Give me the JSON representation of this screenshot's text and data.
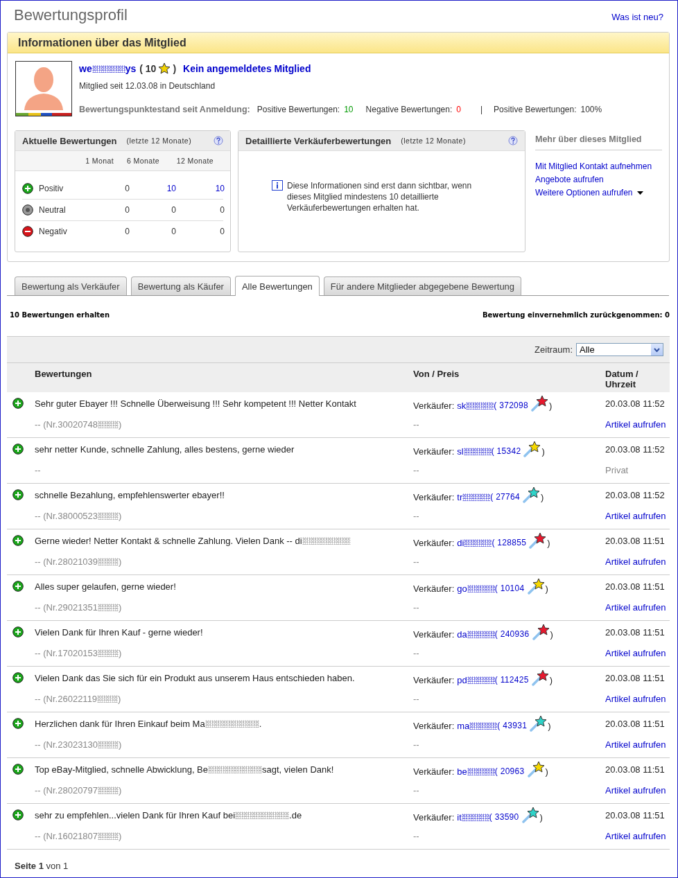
{
  "page_title": "Bewertungsprofil",
  "whats_new": "Was ist neu?",
  "member_panel": {
    "title": "Informationen über das Mitglied",
    "username_parts": [
      "we",
      "ys"
    ],
    "score_open": "( 10",
    "score_close": ")",
    "status": "Kein angemeldetes Mitglied",
    "since": "Mitglied seit 12.03.08 in Deutschland",
    "points_label": "Bewertungspunktestand seit Anmeldung:",
    "points": [
      {
        "kind": "positive",
        "label": "Positive Bewertungen:",
        "value": "10"
      },
      {
        "kind": "negative",
        "label": "Negative Bewertungen:",
        "value": "0"
      },
      {
        "kind": "separator",
        "label": "|"
      },
      {
        "kind": "plain",
        "label": "Positive Bewertungen:",
        "value": "100%"
      }
    ]
  },
  "recent": {
    "title": "Aktuelle Bewertungen",
    "subtitle": "(letzte 12 Monate)",
    "columns": [
      "1 Monat",
      "6 Monate",
      "12 Monate"
    ],
    "rows": [
      {
        "kind": "positive",
        "label": "Positiv",
        "values": [
          {
            "text": "0",
            "link": false
          },
          {
            "text": "10",
            "link": true
          },
          {
            "text": "10",
            "link": true
          }
        ]
      },
      {
        "kind": "neutral",
        "label": "Neutral",
        "values": [
          {
            "text": "0",
            "link": false
          },
          {
            "text": "0",
            "link": false
          },
          {
            "text": "0",
            "link": false
          }
        ]
      },
      {
        "kind": "negative",
        "label": "Negativ",
        "values": [
          {
            "text": "0",
            "link": false
          },
          {
            "text": "0",
            "link": false
          },
          {
            "text": "0",
            "link": false
          }
        ]
      }
    ]
  },
  "detailed": {
    "title": "Detaillierte Verkäuferbewertungen",
    "subtitle": "(letzte 12 Monate)",
    "info": "Diese Informationen sind erst dann sichtbar, wenn dieses Mitglied mindestens 10 detaillierte Verkäuferbewertungen erhalten hat."
  },
  "more": {
    "title": "Mehr über dieses Mitglied",
    "links": [
      {
        "text": "Mit Mitglied Kontakt aufnehmen",
        "dropdown": false
      },
      {
        "text": "Angebote aufrufen",
        "dropdown": false
      },
      {
        "text": "Weitere Optionen aufrufen",
        "dropdown": true
      }
    ]
  },
  "tabs": [
    {
      "label": "Bewertung als Verkäufer",
      "selected": false
    },
    {
      "label": "Bewertung als Käufer",
      "selected": false
    },
    {
      "label": "Alle Bewertungen",
      "selected": true
    },
    {
      "label": "Für andere Mitglieder abgegebene Bewertung",
      "selected": false
    }
  ],
  "summary": {
    "received": "10 Bewertungen erhalten",
    "withdrawn": "Bewertung einvernehmlich zurückgenommen: 0"
  },
  "filter": {
    "label": "Zeitraum:",
    "value": "Alle"
  },
  "columns": [
    "Bewertungen",
    "Von / Preis",
    "Datum / Uhrzeit"
  ],
  "rows": [
    {
      "kind": "positive",
      "comment_parts": [
        "Sehr guter Ebayer !!! Schnelle Überweisung !!! Sehr kompetent !!! Netter Kontakt"
      ],
      "item_parts": [
        "-- (Nr.30020748",
        ")"
      ],
      "role": "Verkäufer:",
      "seller": "sk",
      "seller_score": "( 372098",
      "color": "#e8182e",
      "close": ")",
      "price": "--",
      "date": "20.03.08 11:52",
      "action": {
        "kind": "link",
        "text": "Artikel aufrufen"
      }
    },
    {
      "kind": "positive",
      "comment_parts": [
        "sehr netter Kunde, schnelle Zahlung, alles bestens, gerne wieder"
      ],
      "item_parts": [
        "--"
      ],
      "role": "Verkäufer:",
      "seller": "sl",
      "seller_score": "( 15342",
      "color": "#f5d800",
      "close": ")",
      "price": "--",
      "date": "20.03.08 11:52",
      "action": {
        "kind": "private",
        "text": "Privat"
      }
    },
    {
      "kind": "positive",
      "comment_parts": [
        "schnelle Bezahlung, empfehlenswerter ebayer!!"
      ],
      "item_parts": [
        "-- (Nr.38000523",
        ")"
      ],
      "role": "Verkäufer:",
      "seller": "tr",
      "seller_score": "( 27764",
      "color": "#2ed3c8",
      "close": ")",
      "price": "--",
      "date": "20.03.08 11:52",
      "action": {
        "kind": "link",
        "text": "Artikel aufrufen"
      }
    },
    {
      "kind": "positive",
      "comment_parts": [
        "Gerne wieder! Netter Kontakt & schnelle Zahlung. Vielen Dank -- di"
      ],
      "item_parts": [
        "-- (Nr.28021039",
        ")"
      ],
      "role": "Verkäufer:",
      "seller": "di",
      "seller_score": "( 128855",
      "color": "#e8182e",
      "close": ")",
      "price": "--",
      "date": "20.03.08 11:51",
      "action": {
        "kind": "link",
        "text": "Artikel aufrufen"
      }
    },
    {
      "kind": "positive",
      "comment_parts": [
        "Alles super gelaufen, gerne wieder!"
      ],
      "item_parts": [
        "-- (Nr.29021351",
        ")"
      ],
      "role": "Verkäufer:",
      "seller": "go",
      "seller_score": "( 10104",
      "color": "#f5d800",
      "close": ")",
      "price": "--",
      "date": "20.03.08 11:51",
      "action": {
        "kind": "link",
        "text": "Artikel aufrufen"
      }
    },
    {
      "kind": "positive",
      "comment_parts": [
        "Vielen Dank für Ihren Kauf - gerne wieder!"
      ],
      "item_parts": [
        "-- (Nr.17020153",
        ")"
      ],
      "role": "Verkäufer:",
      "seller": "da",
      "seller_score": "( 240936",
      "color": "#e8182e",
      "close": ")",
      "price": "--",
      "date": "20.03.08 11:51",
      "action": {
        "kind": "link",
        "text": "Artikel aufrufen"
      }
    },
    {
      "kind": "positive",
      "comment_parts": [
        "Vielen Dank das Sie sich für ein Produkt aus unserem Haus entschieden haben."
      ],
      "item_parts": [
        "-- (Nr.26022119",
        ")"
      ],
      "role": "Verkäufer:",
      "seller": "pd",
      "seller_score": "( 112425",
      "color": "#e8182e",
      "close": ")",
      "price": "--",
      "date": "20.03.08 11:51",
      "action": {
        "kind": "link",
        "text": "Artikel aufrufen"
      }
    },
    {
      "kind": "positive",
      "comment_parts": [
        "Herzlichen dank für Ihren Einkauf beim Ma",
        "."
      ],
      "item_parts": [
        "-- (Nr.23023130",
        ")"
      ],
      "role": "Verkäufer:",
      "seller": "ma",
      "seller_score": "( 43931",
      "color": "#2ed3c8",
      "close": ")",
      "price": "--",
      "date": "20.03.08 11:51",
      "action": {
        "kind": "link",
        "text": "Artikel aufrufen"
      }
    },
    {
      "kind": "positive",
      "comment_parts": [
        "Top eBay-Mitglied, schnelle Abwicklung, Be",
        "sagt, vielen Dank!"
      ],
      "item_parts": [
        "-- (Nr.28020797",
        ")"
      ],
      "role": "Verkäufer:",
      "seller": "be",
      "seller_score": "( 20963",
      "color": "#f5d800",
      "close": ")",
      "price": "--",
      "date": "20.03.08 11:51",
      "action": {
        "kind": "link",
        "text": "Artikel aufrufen"
      }
    },
    {
      "kind": "positive",
      "comment_parts": [
        "sehr zu empfehlen...vielen Dank für Ihren Kauf bei",
        ".de"
      ],
      "item_parts": [
        "-- (Nr.16021807",
        ")"
      ],
      "role": "Verkäufer:",
      "seller": "it",
      "seller_score": "( 33590",
      "color": "#2ed3c8",
      "close": ")",
      "price": "--",
      "date": "20.03.08 11:51",
      "action": {
        "kind": "link",
        "text": "Artikel aufrufen"
      }
    }
  ],
  "pager": "**Seite 1** von 1"
}
